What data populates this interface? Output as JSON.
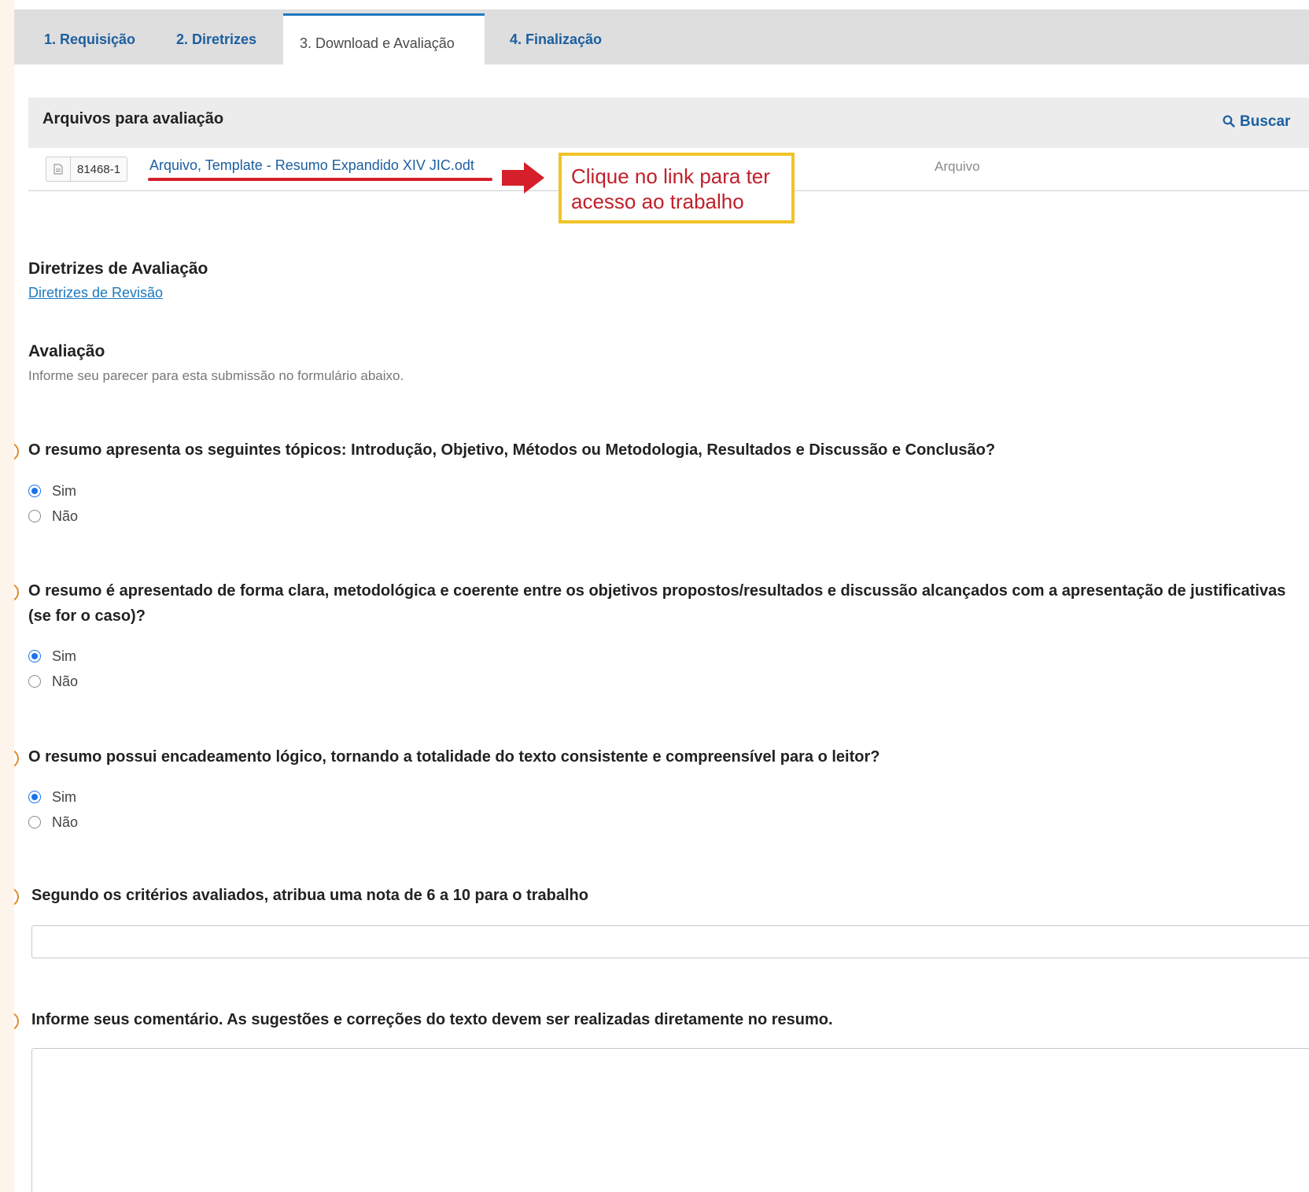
{
  "tabs": [
    {
      "label": "1. Requisição"
    },
    {
      "label": "2. Diretrizes"
    },
    {
      "label": "3. Download e Avaliação"
    },
    {
      "label": "4. Finalização"
    }
  ],
  "active_tab_index": 2,
  "files": {
    "title": "Arquivos para avaliação",
    "search_label": "Buscar",
    "row": {
      "id": "81468-1",
      "name": "Arquivo, Template - Resumo Expandido XIV JIC.odt",
      "type": "Arquivo"
    }
  },
  "annotation": {
    "line1": "Clique no link para ter",
    "line2": "acesso ao trabalho"
  },
  "guidelines": {
    "title": "Diretrizes de Avaliação",
    "link": "Diretrizes de Revisão"
  },
  "review": {
    "title": "Avaliação",
    "description": "Informe seu parecer para esta submissão no formulário abaixo."
  },
  "questions": [
    {
      "text": "O resumo apresenta os seguintes tópicos: Introdução, Objetivo, Métodos ou Metodologia, Resultados e Discussão e Conclusão?",
      "options": [
        "Sim",
        "Não"
      ],
      "selected": "Sim"
    },
    {
      "text": "O resumo é apresentado de forma clara, metodológica e coerente entre os objetivos propostos/resultados e discussão alcançados com a apresentação de justificativas (se for o caso)?",
      "options": [
        "Sim",
        "Não"
      ],
      "selected": "Sim"
    },
    {
      "text": "O resumo possui encadeamento lógico, tornando a totalidade do texto consistente e compreensível para o leitor?",
      "options": [
        "Sim",
        "Não"
      ],
      "selected": "Sim"
    }
  ],
  "grade": {
    "label": "Segundo os critérios avaliados, atribua uma nota de 6 a 10 para o trabalho",
    "value": ""
  },
  "comments": {
    "label": "Informe seus comentário. As sugestões e correções do texto devem ser realizadas diretamente no resumo.",
    "value": ""
  },
  "colors": {
    "link": "#1c5fa0",
    "annotation_border": "#f2c326",
    "annotation_text": "#c0202b",
    "arrow": "#d51f2a",
    "marker": "#e0892c",
    "radio_selected": "#1a73e8"
  },
  "icons": {
    "search": "search-icon",
    "file": "document-icon",
    "arrow": "arrow-right-icon"
  }
}
